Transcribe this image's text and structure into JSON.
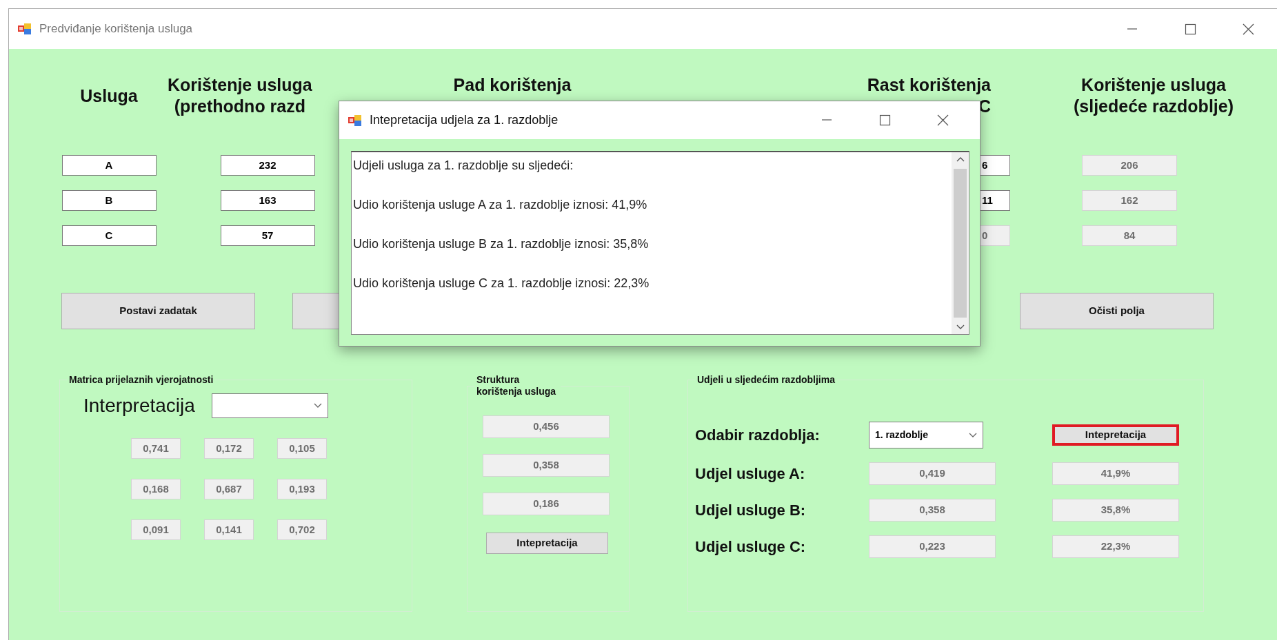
{
  "window": {
    "title": "Predviđanje korištenja usluga"
  },
  "columns": [
    {
      "header_lines": [
        "Usluga"
      ]
    },
    {
      "header_lines": [
        "Korištenje usluga",
        "(prethodno razd"
      ]
    },
    {
      "header_lines": [
        "Pad korištenja"
      ]
    },
    {
      "header_lines": [
        "Rast korištenja",
        "C"
      ]
    },
    {
      "header_lines": [
        "Korištenje usluga",
        "(sljedeće razdoblje)"
      ]
    }
  ],
  "rows": [
    {
      "service": {
        "value": "A",
        "disabled": false
      },
      "previous": {
        "value": "232",
        "disabled": false
      },
      "growth": {
        "value": "6",
        "disabled": false
      },
      "next": {
        "value": "206",
        "disabled": true
      }
    },
    {
      "service": {
        "value": "B",
        "disabled": false
      },
      "previous": {
        "value": "163",
        "disabled": false
      },
      "growth": {
        "value": "11",
        "disabled": false
      },
      "next": {
        "value": "162",
        "disabled": true
      }
    },
    {
      "service": {
        "value": "C",
        "disabled": false
      },
      "previous": {
        "value": "57",
        "disabled": false
      },
      "growth": {
        "value": "0",
        "disabled": true
      },
      "next": {
        "value": "84",
        "disabled": true
      }
    }
  ],
  "action_buttons": [
    {
      "kind": "labeled",
      "label": "Postavi zadatak"
    },
    {
      "kind": "covered"
    },
    {
      "kind": "labeled",
      "label": "Očisti polja"
    }
  ],
  "matrix_group": {
    "legend": "Matrica prijelaznih vjerojatnosti",
    "label": "Interpretacija",
    "cells": [
      [
        "0,741",
        "0,172",
        "0,105"
      ],
      [
        "0,168",
        "0,687",
        "0,193"
      ],
      [
        "0,091",
        "0,141",
        "0,702"
      ]
    ]
  },
  "structure_group": {
    "legend": "Struktura korištenja usluga",
    "values": [
      "0,456",
      "0,358",
      "0,186"
    ],
    "button": {
      "label": "Intepretacija",
      "highlighted": false
    }
  },
  "shares_group": {
    "legend": "Udjeli u sljedećim razdobljima",
    "period_label": "Odabir razdoblja:",
    "period_select": "1. razdoblje",
    "button": {
      "label": "Intepretacija",
      "highlighted": true
    },
    "rows": [
      {
        "label": "Udjel usluge A:",
        "share": "0,419",
        "percent": "41,9%"
      },
      {
        "label": "Udjel usluge B:",
        "share": "0,358",
        "percent": "35,8%"
      },
      {
        "label": "Udjel usluge C:",
        "share": "0,223",
        "percent": "22,3%"
      }
    ]
  },
  "dialog": {
    "title": "Intepretacija udjela za 1. razdoblje",
    "lines": [
      "Udjeli usluga za 1. razdoblje su sljedeći:",
      "Udio korištenja usluge A za 1. razdoblje iznosi: 41,9%",
      "Udio korištenja usluge B za 1. razdoblje iznosi: 35,8%",
      "Udio korištenja usluge C za 1. razdoblje iznosi: 22,3%"
    ]
  }
}
